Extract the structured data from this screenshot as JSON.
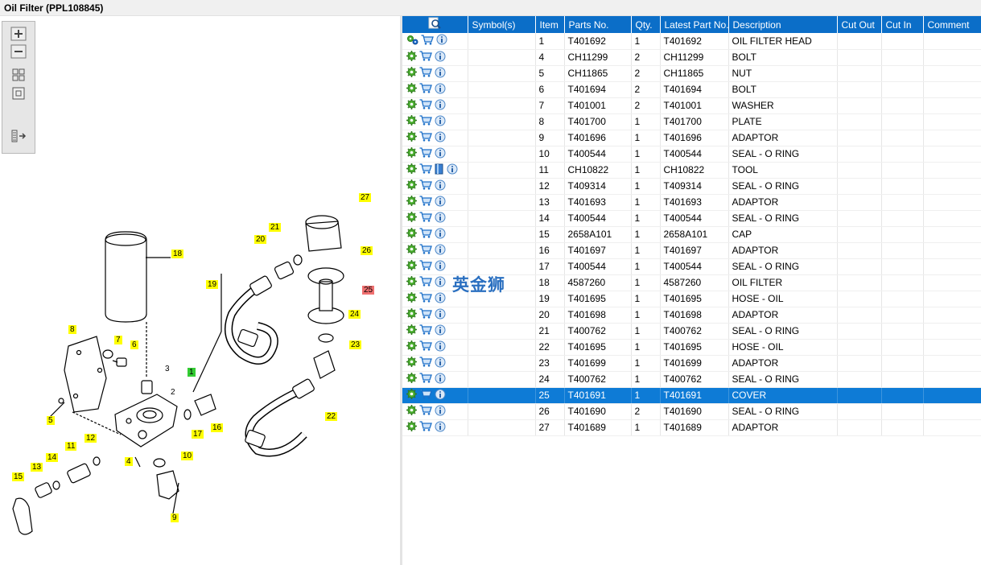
{
  "window": {
    "title": "Oil Filter (PPL108845)"
  },
  "toolbar": {
    "tools": [
      {
        "icon": "zoom-in-icon"
      },
      {
        "icon": "zoom-out-icon"
      },
      {
        "icon": "fit-all-icon"
      },
      {
        "icon": "actual-size-icon"
      },
      {
        "icon": "show-list-icon"
      }
    ]
  },
  "diagram": {
    "callouts": [
      {
        "label": "27",
        "state": "normal"
      },
      {
        "label": "21",
        "state": "normal"
      },
      {
        "label": "20",
        "state": "normal"
      },
      {
        "label": "26",
        "state": "normal"
      },
      {
        "label": "18",
        "state": "normal"
      },
      {
        "label": "19",
        "state": "normal"
      },
      {
        "label": "25",
        "state": "selected"
      },
      {
        "label": "24",
        "state": "normal"
      },
      {
        "label": "8",
        "state": "normal"
      },
      {
        "label": "7",
        "state": "normal"
      },
      {
        "label": "6",
        "state": "normal"
      },
      {
        "label": "23",
        "state": "normal"
      },
      {
        "label": "1",
        "state": "highlight"
      },
      {
        "label": "3",
        "state": "plain"
      },
      {
        "label": "2",
        "state": "plain"
      },
      {
        "label": "5",
        "state": "normal"
      },
      {
        "label": "17",
        "state": "normal"
      },
      {
        "label": "16",
        "state": "normal"
      },
      {
        "label": "22",
        "state": "normal"
      },
      {
        "label": "12",
        "state": "normal"
      },
      {
        "label": "11",
        "state": "normal"
      },
      {
        "label": "4",
        "state": "normal"
      },
      {
        "label": "10",
        "state": "normal"
      },
      {
        "label": "14",
        "state": "normal"
      },
      {
        "label": "13",
        "state": "normal"
      },
      {
        "label": "15",
        "state": "normal"
      },
      {
        "label": "9",
        "state": "normal"
      }
    ],
    "watermark": "英金狮"
  },
  "table": {
    "headers": {
      "symbols": "Symbol(s)",
      "item": "Item",
      "parts_no": "Parts No.",
      "qty": "Qty.",
      "latest": "Latest Part No.",
      "description": "Description",
      "cut_out": "Cut Out",
      "cut_in": "Cut In",
      "comment": "Comment"
    },
    "header_icon": "search-document-icon",
    "rows": [
      {
        "item": "1",
        "parts_no": "T401692",
        "qty": "1",
        "latest": "T401692",
        "description": "OIL FILTER HEAD",
        "icons": [
          "gears-icon",
          "cart-icon",
          "info-icon"
        ],
        "selected": false
      },
      {
        "item": "4",
        "parts_no": "CH11299",
        "qty": "2",
        "latest": "CH11299",
        "description": "BOLT",
        "icons": [
          "gear-icon",
          "cart-icon",
          "info-icon"
        ],
        "selected": false
      },
      {
        "item": "5",
        "parts_no": "CH11865",
        "qty": "2",
        "latest": "CH11865",
        "description": "NUT",
        "icons": [
          "gear-icon",
          "cart-icon",
          "info-icon"
        ],
        "selected": false
      },
      {
        "item": "6",
        "parts_no": "T401694",
        "qty": "2",
        "latest": "T401694",
        "description": "BOLT",
        "icons": [
          "gear-icon",
          "cart-icon",
          "info-icon"
        ],
        "selected": false
      },
      {
        "item": "7",
        "parts_no": "T401001",
        "qty": "2",
        "latest": "T401001",
        "description": "WASHER",
        "icons": [
          "gear-icon",
          "cart-icon",
          "info-icon"
        ],
        "selected": false
      },
      {
        "item": "8",
        "parts_no": "T401700",
        "qty": "1",
        "latest": "T401700",
        "description": "PLATE",
        "icons": [
          "gear-icon",
          "cart-icon",
          "info-icon"
        ],
        "selected": false
      },
      {
        "item": "9",
        "parts_no": "T401696",
        "qty": "1",
        "latest": "T401696",
        "description": "ADAPTOR",
        "icons": [
          "gear-icon",
          "cart-icon",
          "info-icon"
        ],
        "selected": false
      },
      {
        "item": "10",
        "parts_no": "T400544",
        "qty": "1",
        "latest": "T400544",
        "description": "SEAL - O RING",
        "icons": [
          "gear-icon",
          "cart-icon",
          "info-icon"
        ],
        "selected": false
      },
      {
        "item": "11",
        "parts_no": "CH10822",
        "qty": "1",
        "latest": "CH10822",
        "description": "TOOL",
        "icons": [
          "gear-icon",
          "cart-icon",
          "book-icon",
          "info-icon"
        ],
        "selected": false
      },
      {
        "item": "12",
        "parts_no": "T409314",
        "qty": "1",
        "latest": "T409314",
        "description": "SEAL - O RING",
        "icons": [
          "gear-icon",
          "cart-icon",
          "info-icon"
        ],
        "selected": false
      },
      {
        "item": "13",
        "parts_no": "T401693",
        "qty": "1",
        "latest": "T401693",
        "description": "ADAPTOR",
        "icons": [
          "gear-icon",
          "cart-icon",
          "info-icon"
        ],
        "selected": false
      },
      {
        "item": "14",
        "parts_no": "T400544",
        "qty": "1",
        "latest": "T400544",
        "description": "SEAL - O RING",
        "icons": [
          "gear-icon",
          "cart-icon",
          "info-icon"
        ],
        "selected": false
      },
      {
        "item": "15",
        "parts_no": "2658A101",
        "qty": "1",
        "latest": "2658A101",
        "description": "CAP",
        "icons": [
          "gear-icon",
          "cart-icon",
          "info-icon"
        ],
        "selected": false
      },
      {
        "item": "16",
        "parts_no": "T401697",
        "qty": "1",
        "latest": "T401697",
        "description": "ADAPTOR",
        "icons": [
          "gear-icon",
          "cart-icon",
          "info-icon"
        ],
        "selected": false
      },
      {
        "item": "17",
        "parts_no": "T400544",
        "qty": "1",
        "latest": "T400544",
        "description": "SEAL - O RING",
        "icons": [
          "gear-icon",
          "cart-icon",
          "info-icon"
        ],
        "selected": false
      },
      {
        "item": "18",
        "parts_no": "4587260",
        "qty": "1",
        "latest": "4587260",
        "description": "OIL FILTER",
        "icons": [
          "gear-icon",
          "cart-icon",
          "info-icon"
        ],
        "selected": false
      },
      {
        "item": "19",
        "parts_no": "T401695",
        "qty": "1",
        "latest": "T401695",
        "description": "HOSE - OIL",
        "icons": [
          "gear-icon",
          "cart-icon",
          "info-icon"
        ],
        "selected": false
      },
      {
        "item": "20",
        "parts_no": "T401698",
        "qty": "1",
        "latest": "T401698",
        "description": "ADAPTOR",
        "icons": [
          "gear-icon",
          "cart-icon",
          "info-icon"
        ],
        "selected": false
      },
      {
        "item": "21",
        "parts_no": "T400762",
        "qty": "1",
        "latest": "T400762",
        "description": "SEAL - O RING",
        "icons": [
          "gear-icon",
          "cart-icon",
          "info-icon"
        ],
        "selected": false
      },
      {
        "item": "22",
        "parts_no": "T401695",
        "qty": "1",
        "latest": "T401695",
        "description": "HOSE - OIL",
        "icons": [
          "gear-icon",
          "cart-icon",
          "info-icon"
        ],
        "selected": false
      },
      {
        "item": "23",
        "parts_no": "T401699",
        "qty": "1",
        "latest": "T401699",
        "description": "ADAPTOR",
        "icons": [
          "gear-icon",
          "cart-icon",
          "info-icon"
        ],
        "selected": false
      },
      {
        "item": "24",
        "parts_no": "T400762",
        "qty": "1",
        "latest": "T400762",
        "description": "SEAL - O RING",
        "icons": [
          "gear-icon",
          "cart-icon",
          "info-icon"
        ],
        "selected": false
      },
      {
        "item": "25",
        "parts_no": "T401691",
        "qty": "1",
        "latest": "T401691",
        "description": "COVER",
        "icons": [
          "gear-icon",
          "cart-icon",
          "info-icon"
        ],
        "selected": true
      },
      {
        "item": "26",
        "parts_no": "T401690",
        "qty": "2",
        "latest": "T401690",
        "description": "SEAL - O RING",
        "icons": [
          "gear-icon",
          "cart-icon",
          "info-icon"
        ],
        "selected": false
      },
      {
        "item": "27",
        "parts_no": "T401689",
        "qty": "1",
        "latest": "T401689",
        "description": "ADAPTOR",
        "icons": [
          "gear-icon",
          "cart-icon",
          "info-icon"
        ],
        "selected": false
      }
    ]
  },
  "colors": {
    "header_blue": "#0b6ec8",
    "selected_row": "#0e7bd6",
    "callout_yellow": "#ffff00",
    "callout_selected": "#f07070",
    "callout_highlight": "#33cc33"
  }
}
